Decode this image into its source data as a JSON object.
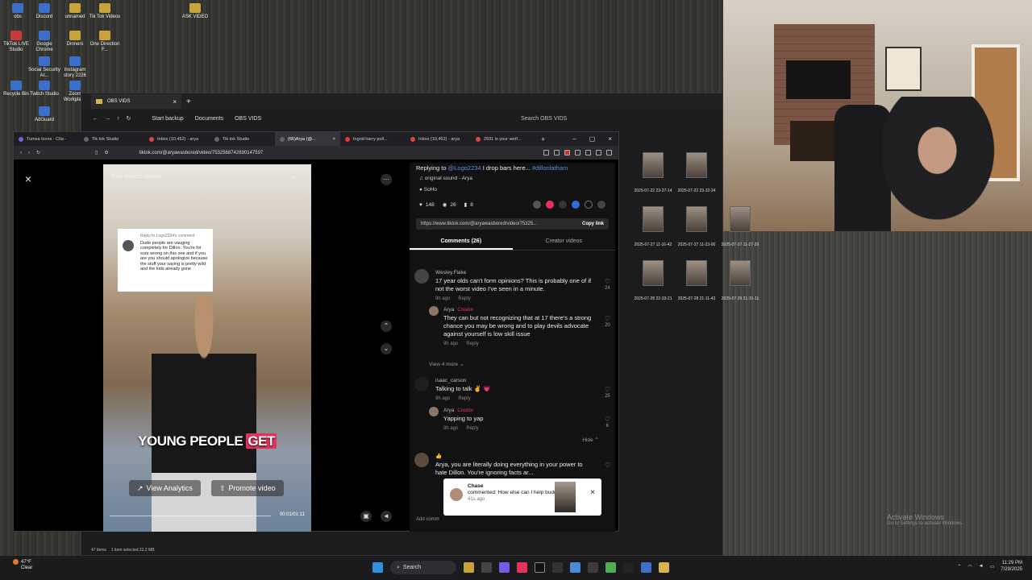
{
  "desktop": {
    "icons": [
      {
        "label": "obs",
        "type": "app"
      },
      {
        "label": "Discord",
        "type": "app"
      },
      {
        "label": "unnamed",
        "type": "folder"
      },
      {
        "label": "Tik Tok Videos",
        "type": "folder"
      },
      {
        "label": "ASK VIDEO",
        "type": "folder"
      },
      {
        "label": "TikTok LIVE Studio",
        "type": "red"
      },
      {
        "label": "Google Chrome",
        "type": "app"
      },
      {
        "label": "Dinners",
        "type": "folder"
      },
      {
        "label": "One Direction F...",
        "type": "folder"
      },
      {
        "label": "Social Security Ar...",
        "type": "app"
      },
      {
        "label": "Instagram story 2226",
        "type": "app"
      },
      {
        "label": "Twitch Studio",
        "type": "app"
      },
      {
        "label": "Zoom Workplace",
        "type": "app"
      },
      {
        "label": "Recycle Bin",
        "type": "app"
      },
      {
        "label": "AdGuard",
        "type": "app"
      }
    ]
  },
  "explorer": {
    "tab_title": "OBS VIDS",
    "breadcrumb": [
      "Start backup",
      "Documents",
      "OBS VIDS"
    ],
    "search_placeholder": "Search OBS VIDS",
    "status": {
      "items": "47 items",
      "selected": "1 item selected  22.2 MB"
    },
    "thumb_labels": [
      "2025-07-22 23-27-14",
      "2025-07-22 23-32-34",
      "2025-07-27 11-16-42",
      "2025-07-27 11-23-00",
      "2025-07-27 11-27-29",
      "2025-07-28 22-33-21",
      "2025-07-28 21-11-43",
      "2025-07-29 21-31-11"
    ]
  },
  "browser": {
    "tabs": [
      "Tumsa Icons - Cita -",
      "Tik tok Studio",
      "Inbox (10,452) - arya",
      "Tik tok Studio",
      "(66)Arya (@...",
      "Ingrid harry poll...",
      "Inbox (10,452) - arya",
      "2931 is your verif..."
    ],
    "active_tab": 4,
    "url": "tiktok.com/@aryawasbored/video/7532568742690147597"
  },
  "video": {
    "search_placeholder": "Find related content",
    "reply_header": "Reply to Logo2234's comment",
    "reply_text": "Dude people are vauging completely for Dillon. You're for sure wrong on this one and if you are you should apologize because the stuff your saying is pretty wild and the kids already gone",
    "caption_before": "YOUNG PEOPLE",
    "caption_highlight": "GET",
    "analytics_label": "View Analytics",
    "promote_label": "Promote video",
    "time": "00:01/01:11"
  },
  "panel": {
    "desc_prefix": "Replying to",
    "desc_mention": "@Logo2234",
    "desc_text": "I drop bars here...",
    "desc_tag": "#dillonlatham",
    "sound": "original sound - Arya",
    "location": "SoHo",
    "likes": "148",
    "comments_count": "26",
    "saves": "8",
    "link": "https://www.tiktok.com/@aryawasbored/video/75325...",
    "copy_label": "Copy link",
    "tab_comments": "Comments (26)",
    "tab_creator": "Creator videos",
    "comments": [
      {
        "user": "Wesley.Flake",
        "text": "17 year olds can't form opinions? This is probably one of if not the worst video I've seen in a minute.",
        "time": "9h ago",
        "reply": "Reply",
        "likes": "24"
      },
      {
        "user": "Arya",
        "creator": "Creator",
        "text": "They can but not recognizing that at 17 there's a strong chance you may be wrong and to play devils advocate against yourself is low skill issue",
        "time": "9h ago",
        "reply": "Reply",
        "likes": "20"
      },
      {
        "user": "isaac_carson",
        "text": "Talking to talk ✌️ 💗",
        "time": "9h ago",
        "reply": "Reply",
        "likes": "25"
      },
      {
        "user": "Arya",
        "creator": "Creator",
        "text": "Yapping to yap",
        "time": "9h ago",
        "reply": "Reply",
        "likes": "6"
      },
      {
        "user": "👍",
        "text": "Arya, you are literally doing everything in your power to hate Dillon. You're ignoring facts ar...",
        "likes": ""
      }
    ],
    "view_more": "View 4 more",
    "hide": "Hide",
    "add_comment": "Add comm",
    "notification": {
      "name": "Chase",
      "text": "commented: How else can I help buddy",
      "time": "41s ago"
    }
  },
  "watermark": {
    "line1": "Activate Windows",
    "line2": "Go to Settings to activate Windows."
  },
  "taskbar": {
    "weather_temp": "47°F",
    "weather_desc": "Clear",
    "search": "Search",
    "time": "11:29 PM",
    "date": "7/29/2025"
  }
}
